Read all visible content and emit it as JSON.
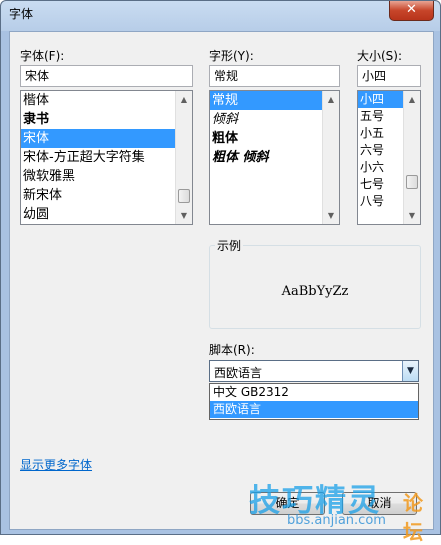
{
  "window": {
    "title": "字体",
    "close_glyph": "✕"
  },
  "font": {
    "label": "字体(F):",
    "value": "宋体",
    "items": [
      "楷体",
      "隶书",
      "宋体",
      "宋体-方正超大字符集",
      "微软雅黑",
      "新宋体",
      "幼圆"
    ],
    "selected_index": 2
  },
  "style": {
    "label": "字形(Y):",
    "value": "常规",
    "items": [
      "常规",
      "倾斜",
      "粗体",
      "粗体 倾斜"
    ],
    "selected_index": 0
  },
  "size": {
    "label": "大小(S):",
    "value": "小四",
    "items": [
      "小四",
      "五号",
      "小五",
      "六号",
      "小六",
      "七号",
      "八号"
    ],
    "selected_index": 0
  },
  "sample": {
    "label": "示例",
    "text": "AaBbYyZz"
  },
  "script": {
    "label": "脚本(R):",
    "value": "西欧语言",
    "options": [
      "中文 GB2312",
      "西欧语言"
    ],
    "selected_index": 1
  },
  "more_fonts_link": "显示更多字体",
  "buttons": {
    "ok": "确定",
    "cancel": "取消"
  },
  "watermark": {
    "big": "技巧精灵",
    "small": "论坛",
    "url": "bbs.anjian.com"
  },
  "icons": {
    "close": "close-icon",
    "scroll_up": "scroll-up-arrow-icon",
    "scroll_down": "scroll-down-arrow-icon",
    "dropdown": "chevron-down-icon"
  }
}
